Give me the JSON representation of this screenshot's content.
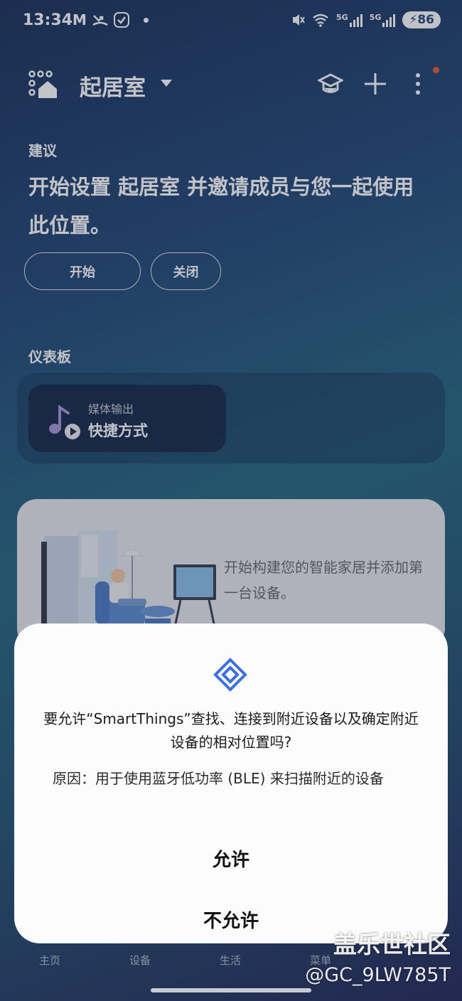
{
  "status_bar": {
    "time": "13:34",
    "notif_m": "M",
    "sig1": "5G",
    "sig2": "5G",
    "battery": "86"
  },
  "topbar": {
    "location": "起居室",
    "icons": [
      "location-home-icon",
      "learn-hat-icon",
      "add-icon",
      "more-vert-icon"
    ]
  },
  "suggestion": {
    "label": "建议",
    "text": "开始设置 起居室 并邀请成员与您一起使用此位置。",
    "start_label": "开始",
    "close_label": "关闭"
  },
  "dashboard": {
    "label": "仪表板",
    "tile_sub": "媒体输出",
    "tile_title": "快捷方式"
  },
  "card": {
    "text": "开始构建您的智能家居并添加第一台设备。"
  },
  "bottom_nav": {
    "items": [
      "主页",
      "设备",
      "生活",
      "菜单"
    ]
  },
  "dialog": {
    "question": "要允许“SmartThings”查找、连接到附近设备以及确定附近设备的相对位置吗?",
    "reason": "原因：用于使用蓝牙低功率 (BLE) 来扫描附近的设备",
    "allow_label": "允许",
    "deny_label": "不允许"
  },
  "watermark": {
    "line1": "盖乐世社区",
    "line2": "@GC_9LW785T"
  },
  "colors": {
    "accent_blue": "#3b6fe0",
    "notification_dot": "#e3623a"
  }
}
